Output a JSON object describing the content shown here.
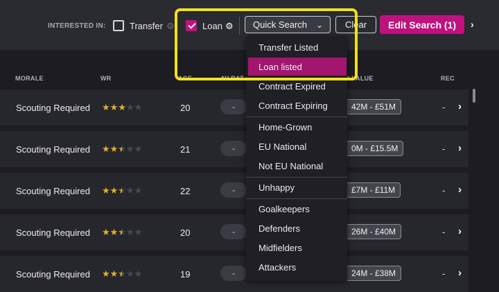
{
  "filters": {
    "interested_in_label": "INTERESTED IN:",
    "transfer_label": "Transfer",
    "transfer_checked": false,
    "loan_label": "Loan",
    "loan_checked": true,
    "quick_search_label": "Quick Search",
    "clear_label": "Clear",
    "edit_search_label": "Edit Search (1)"
  },
  "columns": {
    "morale": "MORALE",
    "wr": "WR",
    "age": "AGE",
    "av_rat": "AV RAT",
    "tr_value": "TR VALUE",
    "rec": "REC"
  },
  "rows": [
    {
      "morale": "Scouting Required",
      "stars": 3,
      "age": "20",
      "av_rat": "-",
      "tr_value": "42M - £51M",
      "rec": "-"
    },
    {
      "morale": "Scouting Required",
      "stars": 2.5,
      "age": "21",
      "av_rat": "-",
      "tr_value": "0M - £15.5M",
      "rec": "-"
    },
    {
      "morale": "Scouting Required",
      "stars": 2.5,
      "age": "22",
      "av_rat": "-",
      "tr_value": "£7M - £11M",
      "rec": "-"
    },
    {
      "morale": "Scouting Required",
      "stars": 2.5,
      "age": "20",
      "av_rat": "-",
      "tr_value": "26M - £40M",
      "rec": "-"
    },
    {
      "morale": "Scouting Required",
      "stars": 2.5,
      "age": "19",
      "av_rat": "-",
      "tr_value": "24M - £38M",
      "rec": "-"
    }
  ],
  "quick_search_menu": [
    "Transfer Listed",
    "Loan listed",
    "Contract Expired",
    "Contract Expiring",
    "Home-Grown",
    "EU National",
    "Not EU National",
    "Unhappy",
    "Goalkeepers",
    "Defenders",
    "Midfielders",
    "Attackers"
  ],
  "quick_search_active": "Loan listed",
  "colors": {
    "accent": "#c0127f",
    "highlight": "#f2e11c",
    "star": "#e2b325"
  },
  "icons": [
    "gear-icon",
    "chevron-down-icon",
    "chevron-right-icon",
    "star-icon"
  ]
}
